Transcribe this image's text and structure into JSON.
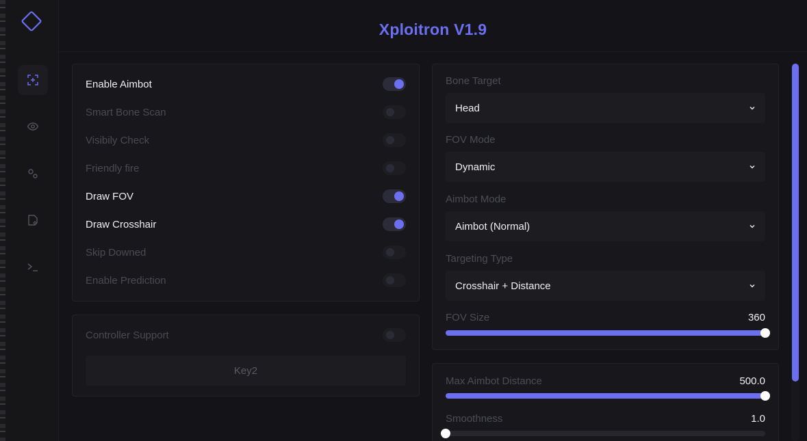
{
  "app": {
    "title": "Xploitron V1.9"
  },
  "sidebar": {
    "items": [
      {
        "icon": "crosshair-icon",
        "active": true
      },
      {
        "icon": "eye-icon",
        "active": false
      },
      {
        "icon": "settings-icon",
        "active": false
      },
      {
        "icon": "config-file-icon",
        "active": false
      },
      {
        "icon": "terminal-icon",
        "active": false
      }
    ]
  },
  "aimbot_panel": {
    "toggles": [
      {
        "label": "Enable Aimbot",
        "enabled": true
      },
      {
        "label": "Smart Bone Scan",
        "enabled": false
      },
      {
        "label": "Visibily Check",
        "enabled": false
      },
      {
        "label": "Friendly fire",
        "enabled": false
      },
      {
        "label": "Draw FOV",
        "enabled": true
      },
      {
        "label": "Draw Crosshair",
        "enabled": true
      },
      {
        "label": "Skip Downed",
        "enabled": false
      },
      {
        "label": "Enable Prediction",
        "enabled": false
      }
    ]
  },
  "controller_panel": {
    "label": "Controller Support",
    "enabled": false,
    "key_label": "Key2"
  },
  "targeting_panel": {
    "bone_target": {
      "label": "Bone Target",
      "value": "Head"
    },
    "fov_mode": {
      "label": "FOV Mode",
      "value": "Dynamic"
    },
    "aimbot_mode": {
      "label": "Aimbot Mode",
      "value": "Aimbot (Normal)"
    },
    "targeting_type": {
      "label": "Targeting Type",
      "value": "Crosshair + Distance"
    },
    "fov_size": {
      "label": "FOV Size",
      "value": "360",
      "fraction": 1.0
    }
  },
  "distance_panel": {
    "max_distance": {
      "label": "Max Aimbot Distance",
      "value": "500.0",
      "fraction": 1.0
    },
    "smoothness": {
      "label": "Smoothness",
      "value": "1.0",
      "fraction": 0.0
    }
  },
  "colors": {
    "accent": "#6b6ff0",
    "background": "#141418",
    "panel": "#18181c"
  }
}
